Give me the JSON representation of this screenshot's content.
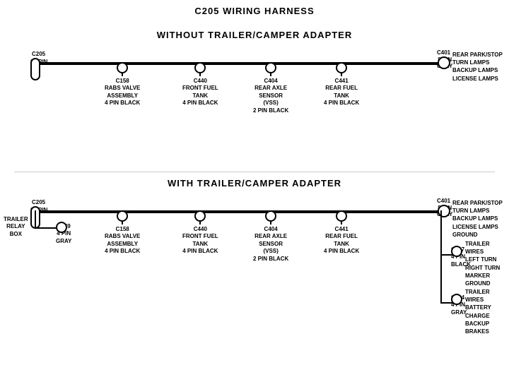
{
  "title": "C205 WIRING HARNESS",
  "section1": {
    "label": "WITHOUT  TRAILER/CAMPER  ADAPTER",
    "left_connector": {
      "id": "C205",
      "pin_label": "24 PIN"
    },
    "right_connector": {
      "id": "C401",
      "pin_label": "8 PIN",
      "color": "GRAY",
      "desc": "REAR PARK/STOP\nTURN LAMPS\nBACKUP LAMPS\nLICENSE LAMPS"
    },
    "connectors": [
      {
        "id": "C158",
        "desc": "RABS VALVE\nASSEMBLY\n4 PIN BLACK"
      },
      {
        "id": "C440",
        "desc": "FRONT FUEL\nTANK\n4 PIN BLACK"
      },
      {
        "id": "C404",
        "desc": "REAR AXLE\nSENSOR\n(VSS)\n2 PIN BLACK"
      },
      {
        "id": "C441",
        "desc": "REAR FUEL\nTANK\n4 PIN BLACK"
      }
    ]
  },
  "section2": {
    "label": "WITH  TRAILER/CAMPER  ADAPTER",
    "left_connector": {
      "id": "C205",
      "pin_label": "24 PIN"
    },
    "right_connector": {
      "id": "C401",
      "pin_label": "8 PIN",
      "color": "GRAY",
      "desc": "REAR PARK/STOP\nTURN LAMPS\nBACKUP LAMPS\nLICENSE LAMPS\nGROUND"
    },
    "connectors": [
      {
        "id": "C158",
        "desc": "RABS VALVE\nASSEMBLY\n4 PIN BLACK"
      },
      {
        "id": "C440",
        "desc": "FRONT FUEL\nTANK\n4 PIN BLACK"
      },
      {
        "id": "C404",
        "desc": "REAR AXLE\nSENSOR\n(VSS)\n2 PIN BLACK"
      },
      {
        "id": "C441",
        "desc": "REAR FUEL\nTANK\n4 PIN BLACK"
      }
    ],
    "extra_left": {
      "trailer_relay": "TRAILER\nRELAY\nBOX",
      "connector": {
        "id": "C149",
        "desc": "4 PIN GRAY"
      }
    },
    "extra_right": [
      {
        "id": "C407",
        "pin_label": "4 PIN",
        "color": "BLACK",
        "desc": "TRAILER WIRES\nLEFT TURN\nRIGHT TURN\nMARKER\nGROUND"
      },
      {
        "id": "C424",
        "pin_label": "4 PIN",
        "color": "GRAY",
        "desc": "TRAILER WIRES\nBATTERY CHARGE\nBACKUP\nBRAKES"
      }
    ]
  }
}
